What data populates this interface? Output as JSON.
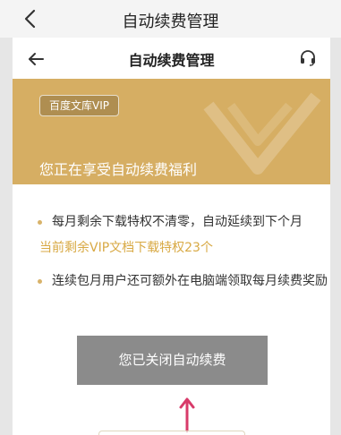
{
  "outer": {
    "title": "自动续费管理",
    "back_icon": "chevron-left-icon"
  },
  "inner": {
    "title": "自动续费管理",
    "back_icon": "arrow-left-icon",
    "support_icon": "headset-icon"
  },
  "banner": {
    "badge": "百度文库VIP",
    "subtitle": "您正在享受自动续费福利"
  },
  "benefits": {
    "items": [
      {
        "text": "每月剩余下载特权不清零，自动延续到下个月",
        "sub": "当前剩余VIP文档下载特权23个"
      },
      {
        "text": "连续包月用户还可额外在电脑端领取每月续费奖励"
      }
    ]
  },
  "status_button": {
    "label": "您已关闭自动续费"
  },
  "colors": {
    "gold": "#d6ae63",
    "gold_text": "#d8a944",
    "button_gray": "#8b8b8b",
    "arrow": "#d83b6a"
  }
}
